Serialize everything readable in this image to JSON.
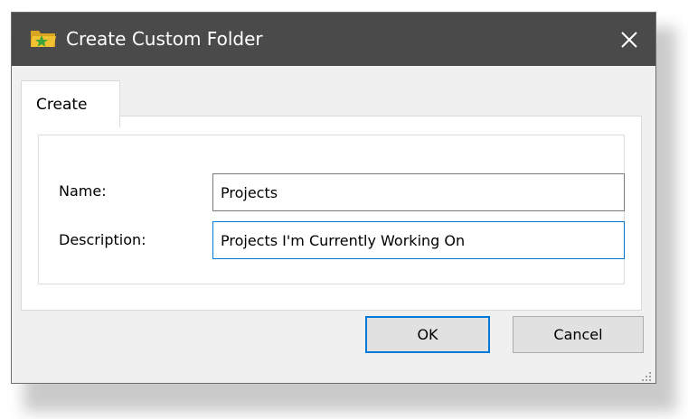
{
  "window": {
    "title": "Create Custom Folder",
    "title_icon": "folder-star-icon",
    "close_glyph": "✕"
  },
  "tabs": [
    {
      "label": "Create",
      "selected": true
    }
  ],
  "form": {
    "name_label": "Name:",
    "name_value": "Projects",
    "description_label": "Description:",
    "description_value": "Projects I'm Currently Working On"
  },
  "buttons": {
    "ok_label": "OK",
    "cancel_label": "Cancel"
  },
  "colors": {
    "titlebar": "#4a4a4a",
    "focus_accent": "#0078d7",
    "folder_yellow": "#f2c230",
    "folder_green": "#3ea53b"
  }
}
